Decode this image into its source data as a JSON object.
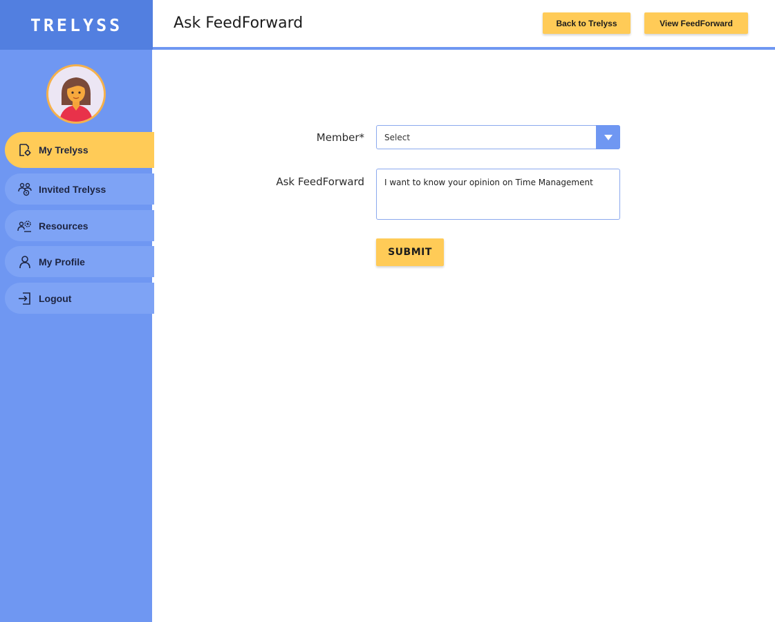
{
  "brand": {
    "name": "TRELYSS"
  },
  "header": {
    "title": "Ask FeedForward",
    "back_button": "Back to Trelyss",
    "view_button": "View FeedForward"
  },
  "sidebar": {
    "avatar": "avatar-woman-icon",
    "items": [
      {
        "label": "My Trelyss",
        "icon": "document-gear-icon",
        "active": true
      },
      {
        "label": "Invited Trelyss",
        "icon": "team-gear-icon",
        "active": false
      },
      {
        "label": "Resources",
        "icon": "people-gear-icon",
        "active": false
      },
      {
        "label": "My Profile",
        "icon": "user-icon",
        "active": false
      },
      {
        "label": "Logout",
        "icon": "logout-icon",
        "active": false
      }
    ]
  },
  "form": {
    "member_label": "Member*",
    "member_select_value": "Select",
    "ask_label": "Ask FeedForward",
    "ask_value": "I want to know your opinion on Time Management",
    "submit_label": "SUBMIT"
  },
  "colors": {
    "sidebar": "#6f97f2",
    "brand_bar": "#527fe0",
    "accent": "#ffcb57",
    "nav_item": "#7ea3f5"
  }
}
